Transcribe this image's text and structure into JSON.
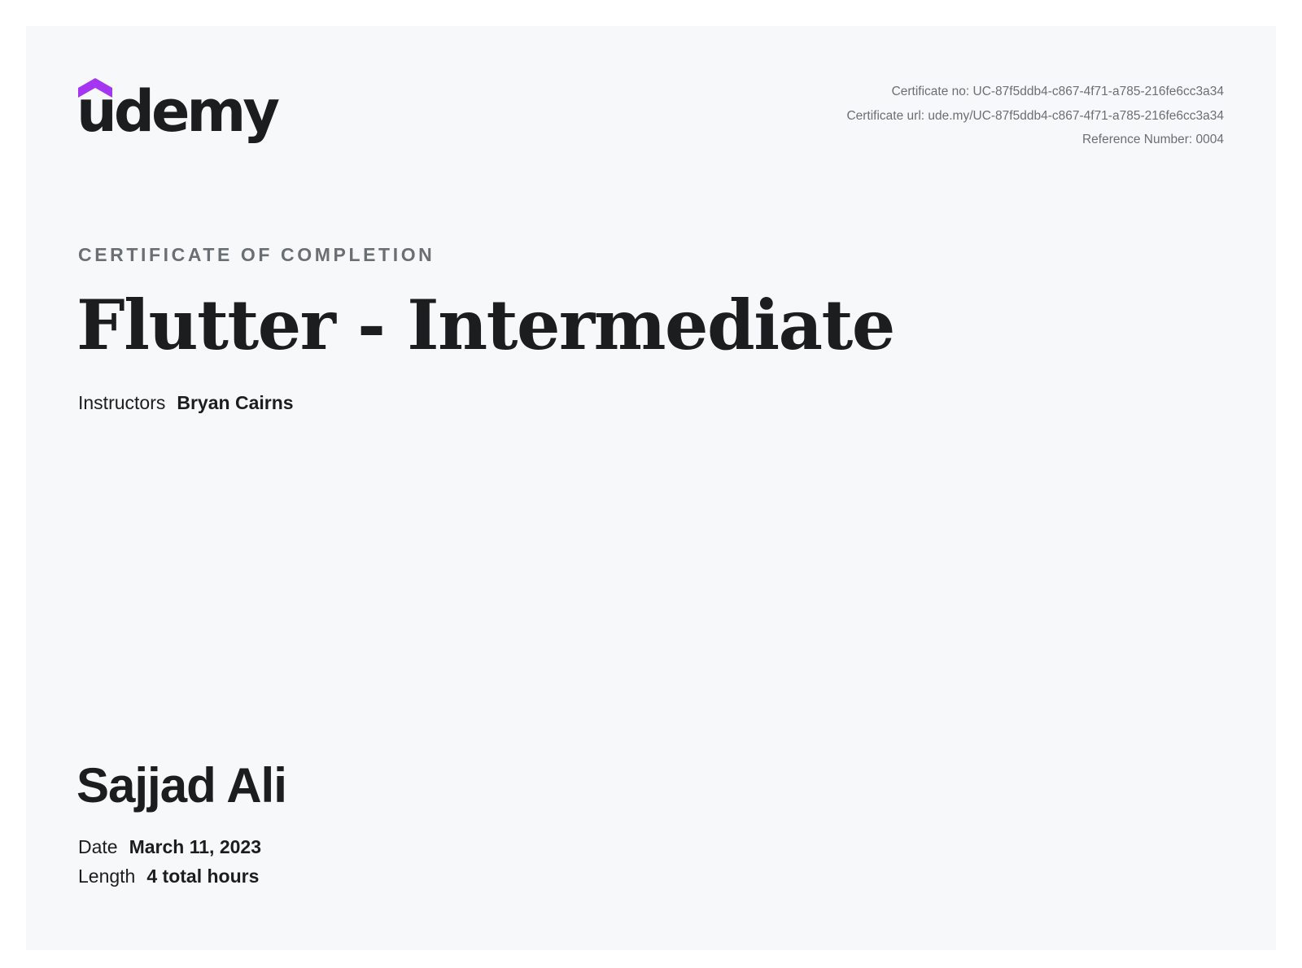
{
  "brand": {
    "logo_text": "udemy",
    "accent_color": "#a435f0"
  },
  "meta": {
    "certificate_no": "Certificate no: UC-87f5ddb4-c867-4f71-a785-216fe6cc3a34",
    "certificate_url": "Certificate url: ude.my/UC-87f5ddb4-c867-4f71-a785-216fe6cc3a34",
    "reference_number": "Reference Number: 0004"
  },
  "certificate": {
    "kicker": "CERTIFICATE OF COMPLETION",
    "course_title": "Flutter - Intermediate",
    "instructors_label": "Instructors",
    "instructors_value": "Bryan Cairns",
    "student_name": "Sajjad Ali",
    "date_label": "Date",
    "date_value": "March 11, 2023",
    "length_label": "Length",
    "length_value": "4 total hours"
  }
}
